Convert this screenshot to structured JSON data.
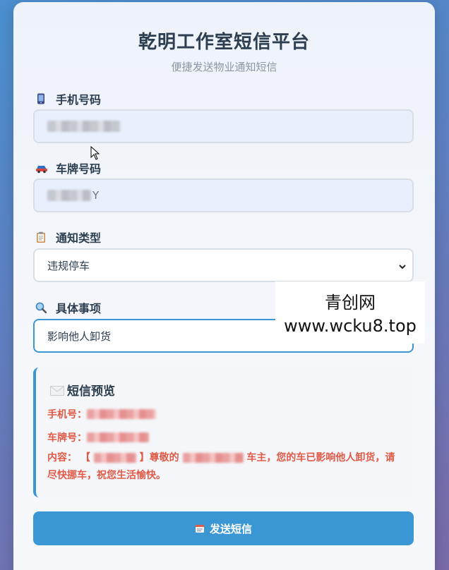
{
  "header": {
    "title": "乾明工作室短信平台",
    "subtitle": "便捷发送物业通知短信"
  },
  "form": {
    "phone": {
      "label": "手机号码",
      "icon": "mobile-phone-icon",
      "value": ""
    },
    "plate": {
      "label": "车牌号码",
      "icon": "car-icon",
      "value_suffix": "Y"
    },
    "notify_type": {
      "label": "通知类型",
      "icon": "clipboard-icon",
      "selected": "违规停车"
    },
    "detail": {
      "label": "具体事项",
      "icon": "magnifier-icon",
      "value": "影响他人卸货"
    }
  },
  "preview": {
    "title": "短信预览",
    "icon": "envelope-icon",
    "phone_label": "手机号：",
    "plate_label": "车牌号：",
    "content_label": "内容：",
    "content_bracket_open": "【",
    "content_bracket_close": "】尊敬的",
    "content_tail": "车主，您的车已影响他人卸货，请尽快挪车，祝您生活愉快。"
  },
  "send_button": {
    "label": "发送短信",
    "icon": "memo-icon"
  },
  "watermark": {
    "line1": "青创网",
    "line2": "www.wcku8.top"
  },
  "colors": {
    "accent": "#3a97d4",
    "alert_text": "#e05a47",
    "title_text": "#2c3e50"
  }
}
